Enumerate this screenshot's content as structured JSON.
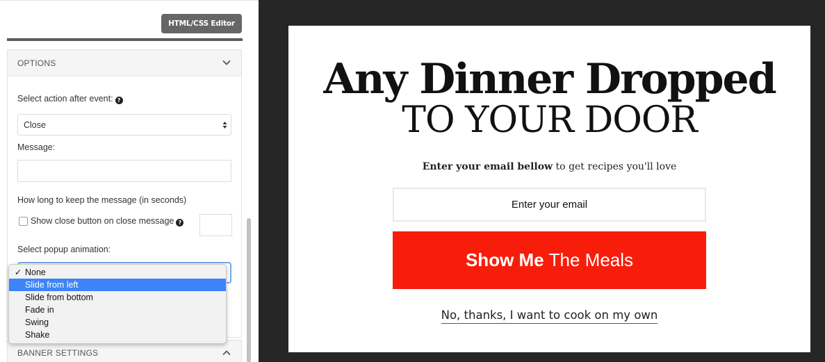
{
  "editor": {
    "button_label": "HTML/CSS Editor"
  },
  "options": {
    "title": "OPTIONS",
    "chevron_icon": "chevron-down-icon",
    "action_label": "Select action after event:",
    "action_value": "Close",
    "message_label": "Message:",
    "message_value": "",
    "duration_label": "How long to keep the message (in seconds)",
    "close_button_label": "Show close button on close message",
    "close_button_checked": false,
    "animation_label": "Select popup animation:",
    "animation_options": [
      "None",
      "Slide from left",
      "Slide from bottom",
      "Fade in",
      "Swing",
      "Shake"
    ],
    "animation_checked": "None",
    "animation_highlighted": "Slide from left"
  },
  "banner": {
    "title": "BANNER SETTINGS",
    "chevron_icon": "chevron-up-icon"
  },
  "popup": {
    "headline_line1": "Any Dinner Dropped",
    "headline_line2": "TO YOUR DOOR",
    "subtext_bold": "Enter your email bellow",
    "subtext_rest": " to get recipes you'll love",
    "email_placeholder": "Enter your email",
    "cta_bold": "Show Me",
    "cta_light": "The Meals",
    "decline_text": "No, thanks, I want to cook on my own"
  },
  "colors": {
    "cta_background": "#f81d0b",
    "preview_frame": "#262626",
    "dropdown_highlight": "#3e83f7",
    "editor_button": "#666666"
  }
}
